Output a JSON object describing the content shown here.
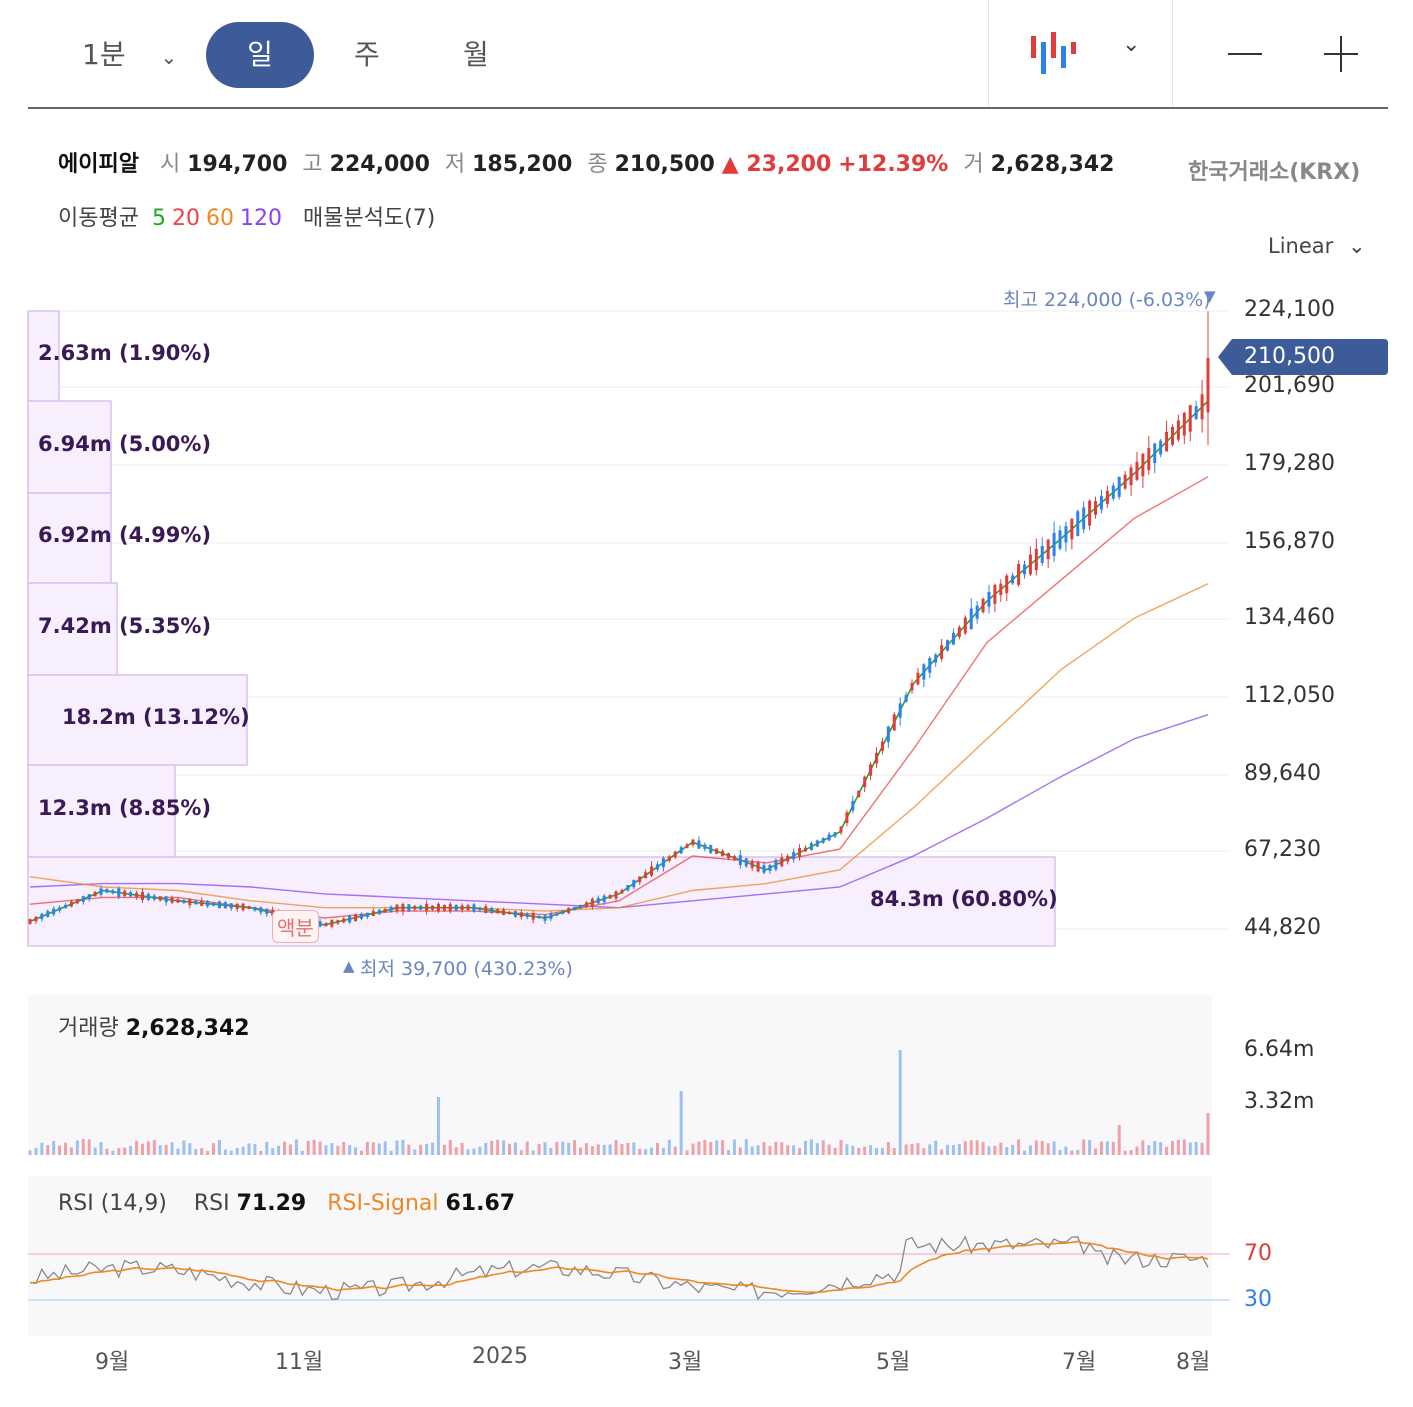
{
  "toolbar": {
    "interval": "1분",
    "tabs": [
      "일",
      "주",
      "월"
    ],
    "active_tab": "일",
    "zoom_out": "—",
    "zoom_in": "+"
  },
  "stock": {
    "name": "에이피알",
    "open_label": "시",
    "open": "194,700",
    "high_label": "고",
    "high": "224,000",
    "low_label": "저",
    "low": "185,200",
    "close_label": "종",
    "close": "210,500",
    "change": "▲ 23,200",
    "change_pct": "+12.39%",
    "volume_label": "거",
    "volume": "2,628,342",
    "exchange": "한국거래소(KRX)"
  },
  "indicators": {
    "ma_label": "이동평균",
    "ma": [
      {
        "period": "5",
        "color": "#22aa22"
      },
      {
        "period": "20",
        "color": "#ee4444"
      },
      {
        "period": "60",
        "color": "#ee8822"
      },
      {
        "period": "120",
        "color": "#8844ee"
      }
    ],
    "vp_label": "매물분석도(7)"
  },
  "scale_mode": "Linear",
  "price_axis": [
    "224,100",
    "201,690",
    "179,280",
    "156,870",
    "134,460",
    "112,050",
    "89,640",
    "67,230",
    "44,820"
  ],
  "current_price_tag": "210,500",
  "high_marker": "최고 224,000 (-6.03%)",
  "low_marker": "최저 39,700 (430.23%)",
  "dividend_marker": "액분",
  "volume_profile": [
    {
      "label": "2.63m (1.90%)"
    },
    {
      "label": "6.94m (5.00%)"
    },
    {
      "label": "6.92m (4.99%)"
    },
    {
      "label": "7.42m (5.35%)"
    },
    {
      "label": "18.2m (13.12%)"
    },
    {
      "label": "12.3m (8.85%)"
    },
    {
      "label": "84.3m (60.80%)"
    }
  ],
  "volume_panel": {
    "label": "거래량",
    "value": "2,628,342",
    "axis": [
      "6.64m",
      "3.32m"
    ]
  },
  "rsi_panel": {
    "label": "RSI (14,9)",
    "rsi_label": "RSI",
    "rsi_value": "71.29",
    "signal_label": "RSI-Signal",
    "signal_value": "61.67",
    "levels": [
      "70",
      "30"
    ]
  },
  "time_axis": [
    "9월",
    "11월",
    "2025",
    "3월",
    "5월",
    "7월",
    "8월"
  ],
  "colors": {
    "up": "#e03c3c",
    "down": "#2f80ed",
    "accent": "#3d5a99"
  },
  "chart_data": {
    "type": "line",
    "title": "에이피알",
    "series": [
      {
        "name": "5",
        "values": [
          47000,
          56000,
          53000,
          51000,
          46000,
          51000,
          51000,
          48000,
          55000,
          70000,
          62000,
          73000,
          116000,
          140000,
          158000,
          177000,
          198000
        ]
      },
      {
        "name": "20",
        "values": [
          52000,
          54000,
          54000,
          51000,
          48000,
          50000,
          50000,
          49000,
          53000,
          66000,
          64000,
          68000,
          97000,
          128000,
          146000,
          164000,
          176000
        ]
      },
      {
        "name": "60",
        "values": [
          60000,
          57000,
          56000,
          53000,
          51000,
          51000,
          51000,
          50000,
          51000,
          56000,
          58000,
          62000,
          80000,
          100000,
          120000,
          135000,
          145000
        ]
      },
      {
        "name": "120",
        "values": [
          57000,
          58000,
          58000,
          57000,
          55000,
          54000,
          53000,
          52000,
          51000,
          53000,
          55000,
          57000,
          66000,
          77000,
          89000,
          100000,
          107000
        ]
      }
    ],
    "ylim": [
      40000,
      226000
    ]
  }
}
